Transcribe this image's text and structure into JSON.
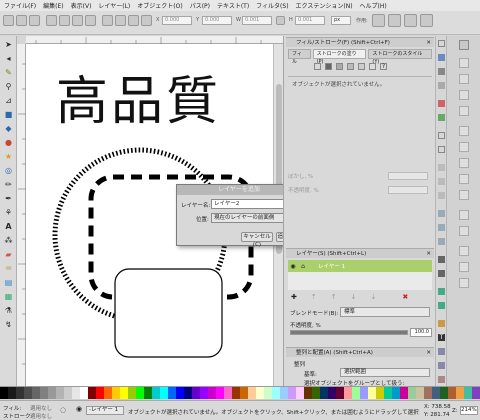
{
  "menu": [
    "ファイル(F)",
    "編集(E)",
    "表示(V)",
    "レイヤー(L)",
    "オブジェクト(O)",
    "パス(P)",
    "テキスト(T)",
    "フィルタ(S)",
    "エクステンション(N)",
    "ヘルプ(H)"
  ],
  "toolbar": {
    "x_label": "X",
    "x_value": "0.000",
    "y_label": "Y",
    "y_value": "0.000",
    "w_label": "W",
    "w_value": "0.001",
    "h_label": "H",
    "h_value": "0.001",
    "unit": "px",
    "affect_label": "作用:"
  },
  "canvas": {
    "heading": "高品質"
  },
  "dialog": {
    "title": "レイヤーを追加",
    "name_label": "レイヤー名:",
    "name_value": "レイヤー2",
    "position_label": "位置:",
    "position_value": "現在のレイヤーの前面側",
    "cancel": "キャンセル(C)",
    "add": "追加(A)"
  },
  "fill_stroke": {
    "title": "フィル/ストローク(F) (Shift+Ctrl+F)",
    "tab_fill": "フィル",
    "tab_stroke_paint": "ストロークの塗り(P)",
    "tab_stroke_style": "ストロークのスタイル(Y)",
    "no_selection": "オブジェクトが選択されていません。",
    "blur_label": "ぼかし, %",
    "opacity_label": "不透明度, %"
  },
  "layers": {
    "title": "レイヤー(S) (Shift+Ctrl+L)",
    "layer1_name": "レイヤー 1",
    "blend_label": "ブレンドモード(B):",
    "blend_value": "標準",
    "opacity_label": "不透明度, %",
    "opacity_value": "100.0"
  },
  "align": {
    "title": "整列と配置(A) (Shift+Ctrl+A)",
    "align_section": "整列",
    "relative_label": "基準:",
    "relative_value": "選択範囲",
    "group_label": "選択オブジェクトをグループとして扱う:"
  },
  "status": {
    "fill_label": "フィル:",
    "stroke_label": "ストローク:",
    "fill_value": "適用なし",
    "stroke_value": "適用なし",
    "layer_label": "-レイヤー 1",
    "message": "オブジェクトが選択されていません。オブジェクトをクリック、Shift+クリック、または囲むようにドラッグして選択",
    "x_coord": "X: 738.58",
    "y_coord": "Y: 281.74",
    "zoom_label": "Z:",
    "zoom_value": "214%"
  },
  "colors": {
    "accent_green": "#a9d06b",
    "dialog_title_bg": "#b7b7b7",
    "canvas_bg": "#ffffff",
    "window_bg": "#d6d6d6"
  },
  "palette": [
    "#000000",
    "#1a1a1a",
    "#333333",
    "#4d4d4d",
    "#666666",
    "#808080",
    "#999999",
    "#b3b3b3",
    "#cccccc",
    "#e6e6e6",
    "#ffffff",
    "#800000",
    "#ff0000",
    "#ff6600",
    "#ffcc00",
    "#ffff00",
    "#99cc00",
    "#00ff00",
    "#008000",
    "#00cccc",
    "#00ffff",
    "#0066ff",
    "#0000ff",
    "#000080",
    "#6600cc",
    "#9900ff",
    "#cc00cc",
    "#ff00ff",
    "#ff66cc",
    "#993300",
    "#cc6600",
    "#ffcc99",
    "#ffffcc",
    "#ccffcc",
    "#99ffff",
    "#99ccff",
    "#cc99ff",
    "#ffccff",
    "#663300",
    "#336600",
    "#003366",
    "#330066",
    "#660033",
    "#ff9999",
    "#99ff99",
    "#9999ff",
    "#ffff99",
    "#cccc00",
    "#00cc99",
    "#0099cc",
    "#cc0099",
    "#99cc99",
    "#ccc2a0",
    "#a07060",
    "#406080",
    "#206020",
    "#b06030",
    "#f0a040",
    "#40c0a0",
    "#8040c0"
  ],
  "icons": {
    "left": [
      "select-arrow-icon",
      "node-tool-icon",
      "tweak-tool-icon",
      "zoom-tool-icon",
      "measure-tool-icon",
      "rect-tool-icon",
      "box3d-tool-icon",
      "ellipse-tool-icon",
      "star-tool-icon",
      "spiral-tool-icon",
      "pencil-tool-icon",
      "pen-tool-icon",
      "calligraphy-tool-icon",
      "text-tool-icon",
      "spray-tool-icon",
      "eraser-tool-icon",
      "bucket-tool-icon",
      "gradient-tool-icon",
      "mesh-tool-icon",
      "dropper-tool-icon",
      "connector-tool-icon"
    ]
  }
}
